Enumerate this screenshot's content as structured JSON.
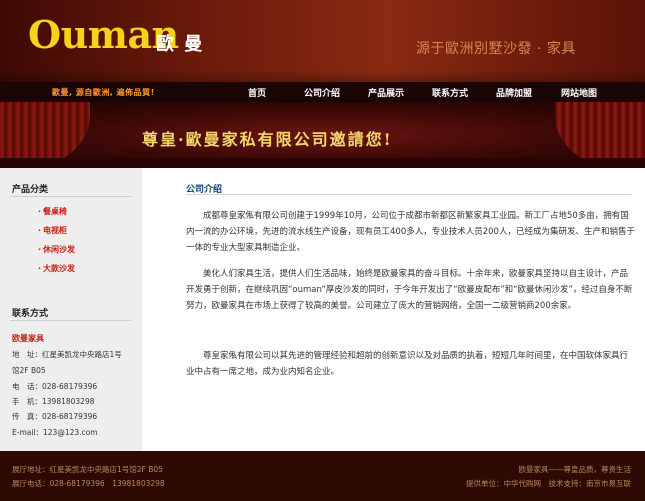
{
  "header": {
    "logo_text": "Ouman",
    "logo_cn": "歐 曼",
    "slogan": "源于歐洲別墅沙發 · 家具"
  },
  "nav": {
    "tagline": "歐曼, 源自歐洲, 遍佈品質!",
    "items": [
      "首页",
      "公司介绍",
      "产品展示",
      "联系方式",
      "品牌加盟",
      "网站地图"
    ]
  },
  "banner": {
    "text": "尊皇·歐曼家私有限公司邀請您!"
  },
  "sidebar": {
    "products_title": "产品分类",
    "products": [
      "餐桌椅",
      "电视柜",
      "休闲沙发",
      "大款沙发"
    ],
    "contact_title": "联系方式",
    "company": "欧曼家具",
    "rows": [
      "地　址：红星美凯龙中央路店1号",
      "馆2F B05",
      "电　话：028-68179396",
      "手　机：13981803298",
      "传　真：028-68179396",
      "E-mail：123@123.com"
    ]
  },
  "main": {
    "title": "公司介绍",
    "paragraphs": [
      "成都尊皇家俬有限公司创建于1999年10月，公司位于成都市新都区新繁家具工业园。新工厂占地50多亩，拥有国内一流的办公环境，先进的流水线生产设备，现有员工400多人，专业技术人员200人，已经成为集研发、生产和销售于一体的专业大型家具制造企业。",
      "美化人们家具生活，提供人们生活品味，始终是欧曼家具的奋斗目标。十余年来，欧曼家具坚持以自主设计，产品开发勇于创新，在继续巩固“ouman”厚皮沙发的同时，于今年开发出了“欧曼皮配布”和“欧曼休闲沙发”，经过自身不断努力，欧曼家具在市场上获得了较高的美誉。公司建立了庞大的营销网络，全国一二级营销商200余家。",
      "尊皇家俬有限公司以其先进的管理经验和超前的创新意识以及对品质的执着，短短几年时间里，在中国软体家具行业中占有一席之地，成为业内知名企业。"
    ]
  },
  "footer": {
    "address": "展厅地址：红星美凯龙中央路店1号馆2F B05",
    "phone": "展厅电话：028-68179396　13981803298",
    "right_top": "欧曼家具——尊皇品质，尊贵生活",
    "right_bottom": "提供单位：中华代购网　技术支持：南京市易互联"
  }
}
